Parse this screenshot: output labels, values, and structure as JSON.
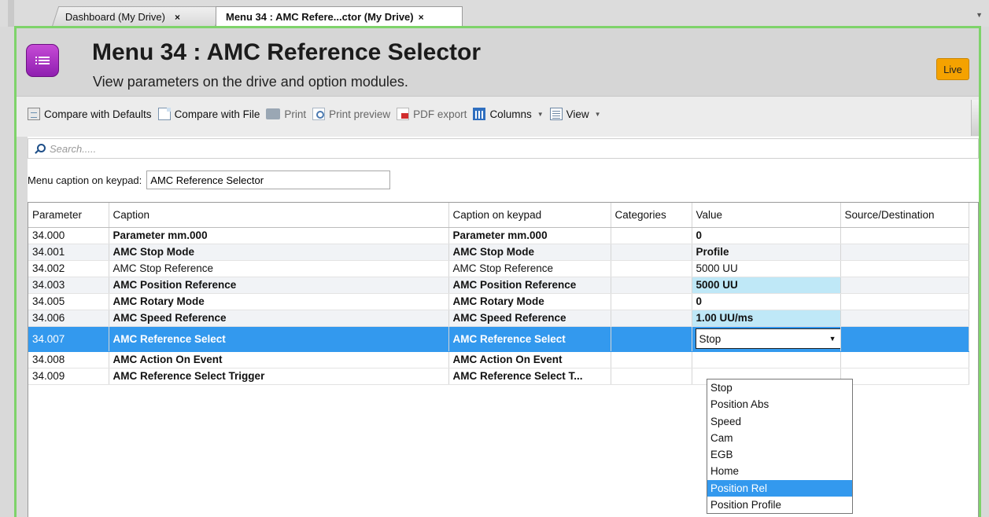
{
  "tabs": [
    {
      "label": "Dashboard (My Drive)",
      "active": false
    },
    {
      "label": "Menu 34 : AMC Refere...ctor (My Drive)",
      "active": true
    }
  ],
  "tab_close_glyph": "×",
  "header": {
    "title": "Menu 34 : AMC Reference Selector",
    "subtitle": "View parameters on the drive and option modules.",
    "status_badge": "Live",
    "icon": "menu-list-icon",
    "badge_color": "#f5a200",
    "icon_color": "#a833c4"
  },
  "toolbar": {
    "compare_defaults": "Compare with Defaults",
    "compare_file": "Compare with File",
    "print": "Print",
    "print_preview": "Print preview",
    "pdf_export": "PDF export",
    "columns": "Columns",
    "view": "View"
  },
  "search": {
    "placeholder": "Search....."
  },
  "caption_on_keypad": {
    "label": "Menu caption on keypad:",
    "value": "AMC Reference Selector"
  },
  "table": {
    "columns": [
      "Parameter",
      "Caption",
      "Caption on keypad",
      "Categories",
      "Value",
      "Source/Destination"
    ],
    "rows": [
      {
        "parameter": "34.000",
        "caption": "Parameter mm.000",
        "keypad": "Parameter mm.000",
        "categories": "",
        "value": "0",
        "source": ""
      },
      {
        "parameter": "34.001",
        "caption": "AMC Stop Mode",
        "keypad": "AMC Stop Mode",
        "categories": "",
        "value": "Profile",
        "source": ""
      },
      {
        "parameter": "34.002",
        "caption": "AMC Stop Reference",
        "keypad": "AMC Stop Reference",
        "categories": "",
        "value": "5000 UU",
        "source": ""
      },
      {
        "parameter": "34.003",
        "caption": "AMC Position Reference",
        "keypad": "AMC Position Reference",
        "categories": "",
        "value": "5000 UU",
        "source": ""
      },
      {
        "parameter": "34.005",
        "caption": "AMC Rotary Mode",
        "keypad": "AMC Rotary Mode",
        "categories": "",
        "value": "0",
        "source": ""
      },
      {
        "parameter": "34.006",
        "caption": "AMC Speed Reference",
        "keypad": "AMC Speed Reference",
        "categories": "",
        "value": "1.00 UU/ms",
        "source": ""
      },
      {
        "parameter": "34.007",
        "caption": "AMC Reference Select",
        "keypad": "AMC Reference Select",
        "categories": "",
        "value": "Stop",
        "source": ""
      },
      {
        "parameter": "34.008",
        "caption": "AMC Action On Event",
        "keypad": "AMC Action On Event",
        "categories": "",
        "value": "",
        "source": ""
      },
      {
        "parameter": "34.009",
        "caption": "AMC Reference Select Trigger",
        "keypad": "AMC Reference Select T...",
        "categories": "",
        "value": "",
        "source": ""
      }
    ],
    "selected_row": 6,
    "selection_color": "#3399ee",
    "value_highlight_color": "#bfe8f7"
  },
  "dropdown": {
    "options": [
      "Stop",
      "Position Abs",
      "Speed",
      "Cam",
      "EGB",
      "Home",
      "Position Rel",
      "Position Profile"
    ],
    "highlighted": "Position Rel"
  }
}
